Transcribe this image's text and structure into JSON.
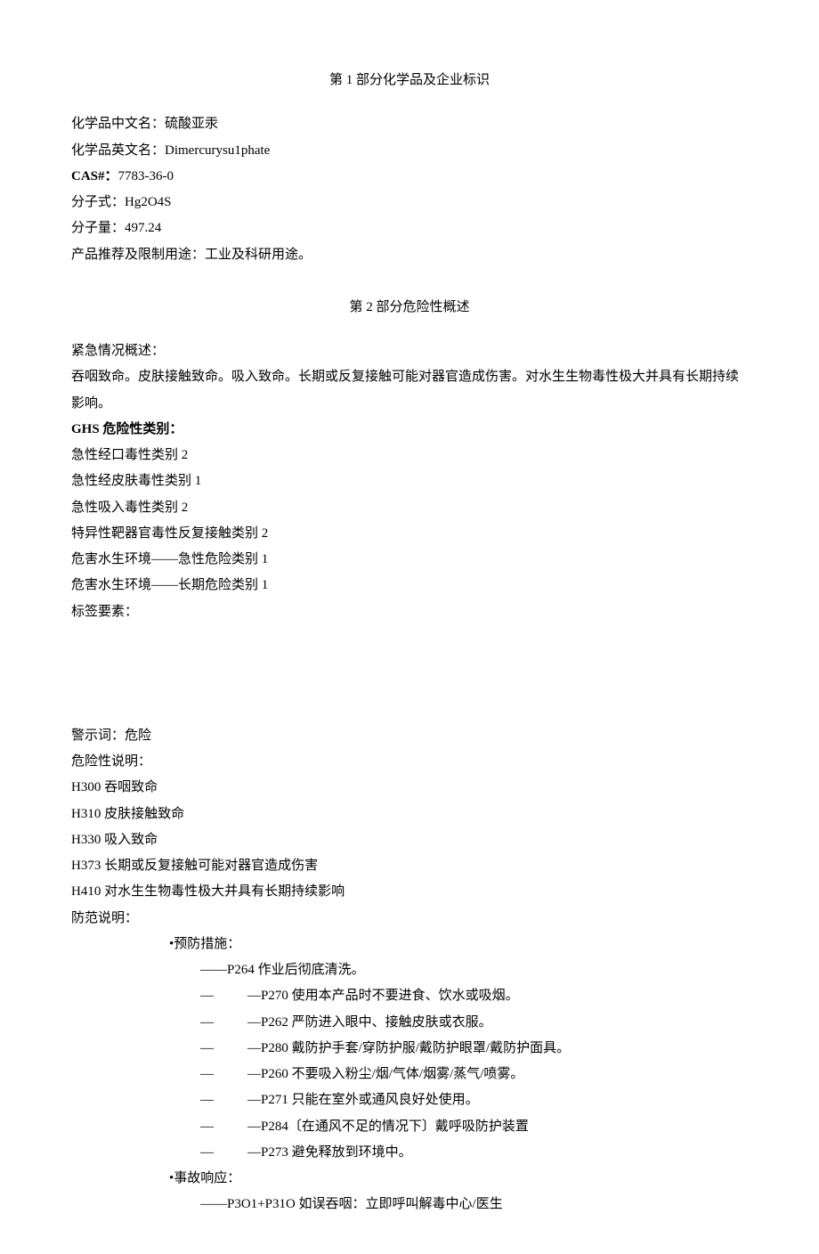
{
  "section1": {
    "title": "第 1 部分化学品及企业标识",
    "name_zh_label": "化学品中文名：",
    "name_zh_value": "硫酸亚汞",
    "name_en_label": "化学品英文名：",
    "name_en_value": "Dimercurysu1phate",
    "cas_label": "CAS#：",
    "cas_value": "7783-36-0",
    "formula_label": "分子式：",
    "formula_value": "Hg2O4S",
    "weight_label": "分子量：",
    "weight_value": "497.24",
    "use_label": "产品推荐及限制用途：",
    "use_value": "工业及科研用途。"
  },
  "section2": {
    "title": "第 2 部分危险性概述",
    "emergency_label": "紧急情况概述：",
    "emergency_text": "吞咽致命。皮肤接触致命。吸入致命。长期或反复接触可能对器官造成伤害。对水生生物毒性极大并具有长期持续影响。",
    "ghs_label": "GHS 危险性类别：",
    "ghs_items": [
      "急性经口毒性类别 2",
      "急性经皮肤毒性类别 1",
      "急性吸入毒性类别 2",
      "特异性靶器官毒性反复接触类别 2",
      "危害水生环境——急性危险类别 1",
      "危害水生环境——长期危险类别 1"
    ],
    "label_elements": "标签要素：",
    "signal_word_label": "警示词：",
    "signal_word_value": "危险",
    "hazard_statements_label": "危险性说明：",
    "hazard_statements": [
      "H300 吞咽致命",
      "H310 皮肤接触致命",
      "H330 吸入致命",
      "H373 长期或反复接触可能对器官造成伤害",
      "H410 对水生生物毒性极大并具有长期持续影响"
    ],
    "precaution_label": "防范说明：",
    "prevention_label": "•预防措施：",
    "prevention_first": "——P264 作业后彻底清洗。",
    "prevention_items": [
      "—P270 使用本产品时不要进食、饮水或吸烟。",
      "—P262 严防进入眼中、接触皮肤或衣服。",
      "—P280 戴防护手套/穿防护服/戴防护眼罩/戴防护面具。",
      "—P260 不要吸入粉尘/烟/气体/烟雾/蒸气/喷雾。",
      "—P271 只能在室外或通风良好处使用。",
      "—P284〔在通风不足的情况下〕戴呼吸防护装置",
      "—P273 避免释放到环境中。"
    ],
    "response_label": "•事故响应：",
    "response_first": "——P3O1+P31O 如误吞咽：立即呼叫解毒中心/医生"
  }
}
